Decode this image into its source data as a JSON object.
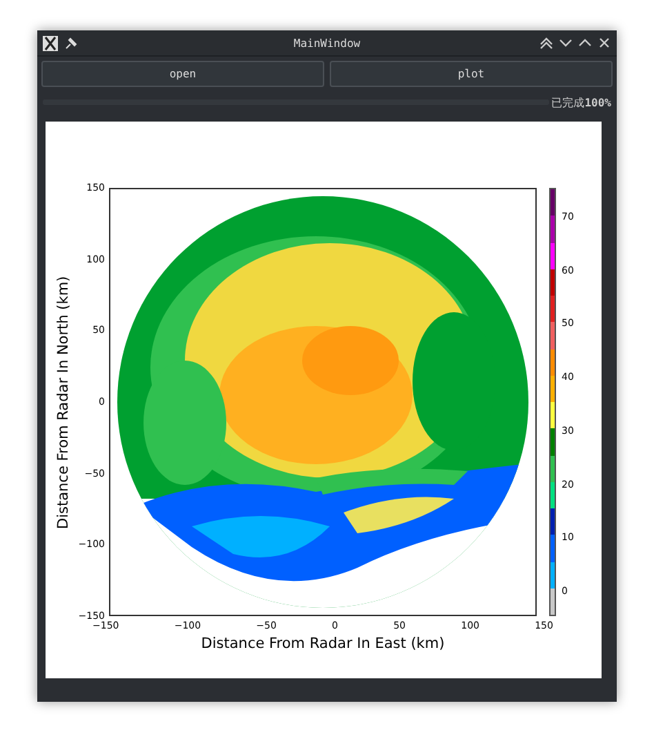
{
  "window": {
    "title": "MainWindow"
  },
  "buttons": [
    "open",
    "plot"
  ],
  "progress": {
    "level": 1,
    "text": "已完成**100%**"
  },
  "plot": {
    "xlabel": "Distance From Radar In East (km)",
    "ylabel": "Distance From Radar In North (km)",
    "xticks": [
      "−150",
      "−100",
      "−50",
      "0",
      "50",
      "100",
      "150"
    ],
    "yticks": [
      "150",
      "100",
      "50",
      "0",
      "−50",
      "−100",
      "−150"
    ],
    "colorbar": {
      "ticks": [
        "70",
        "60",
        "50",
        "40",
        "30",
        "20",
        "10",
        "0"
      ],
      "bands": [
        {
          "color": "#660066"
        },
        {
          "color": "#aa00aa"
        },
        {
          "color": "#ff00ff"
        },
        {
          "color": "#c00000"
        },
        {
          "color": "#e02020"
        },
        {
          "color": "#f06060"
        },
        {
          "color": "#ff8c00"
        },
        {
          "color": "#ffb000"
        },
        {
          "color": "#ffff40"
        },
        {
          "color": "#008000"
        },
        {
          "color": "#30c050"
        },
        {
          "color": "#00e080"
        },
        {
          "color": "#0020b0"
        },
        {
          "color": "#0060ff"
        },
        {
          "color": "#00b0ff"
        },
        {
          "color": "#c8c8c8"
        }
      ]
    }
  }
}
